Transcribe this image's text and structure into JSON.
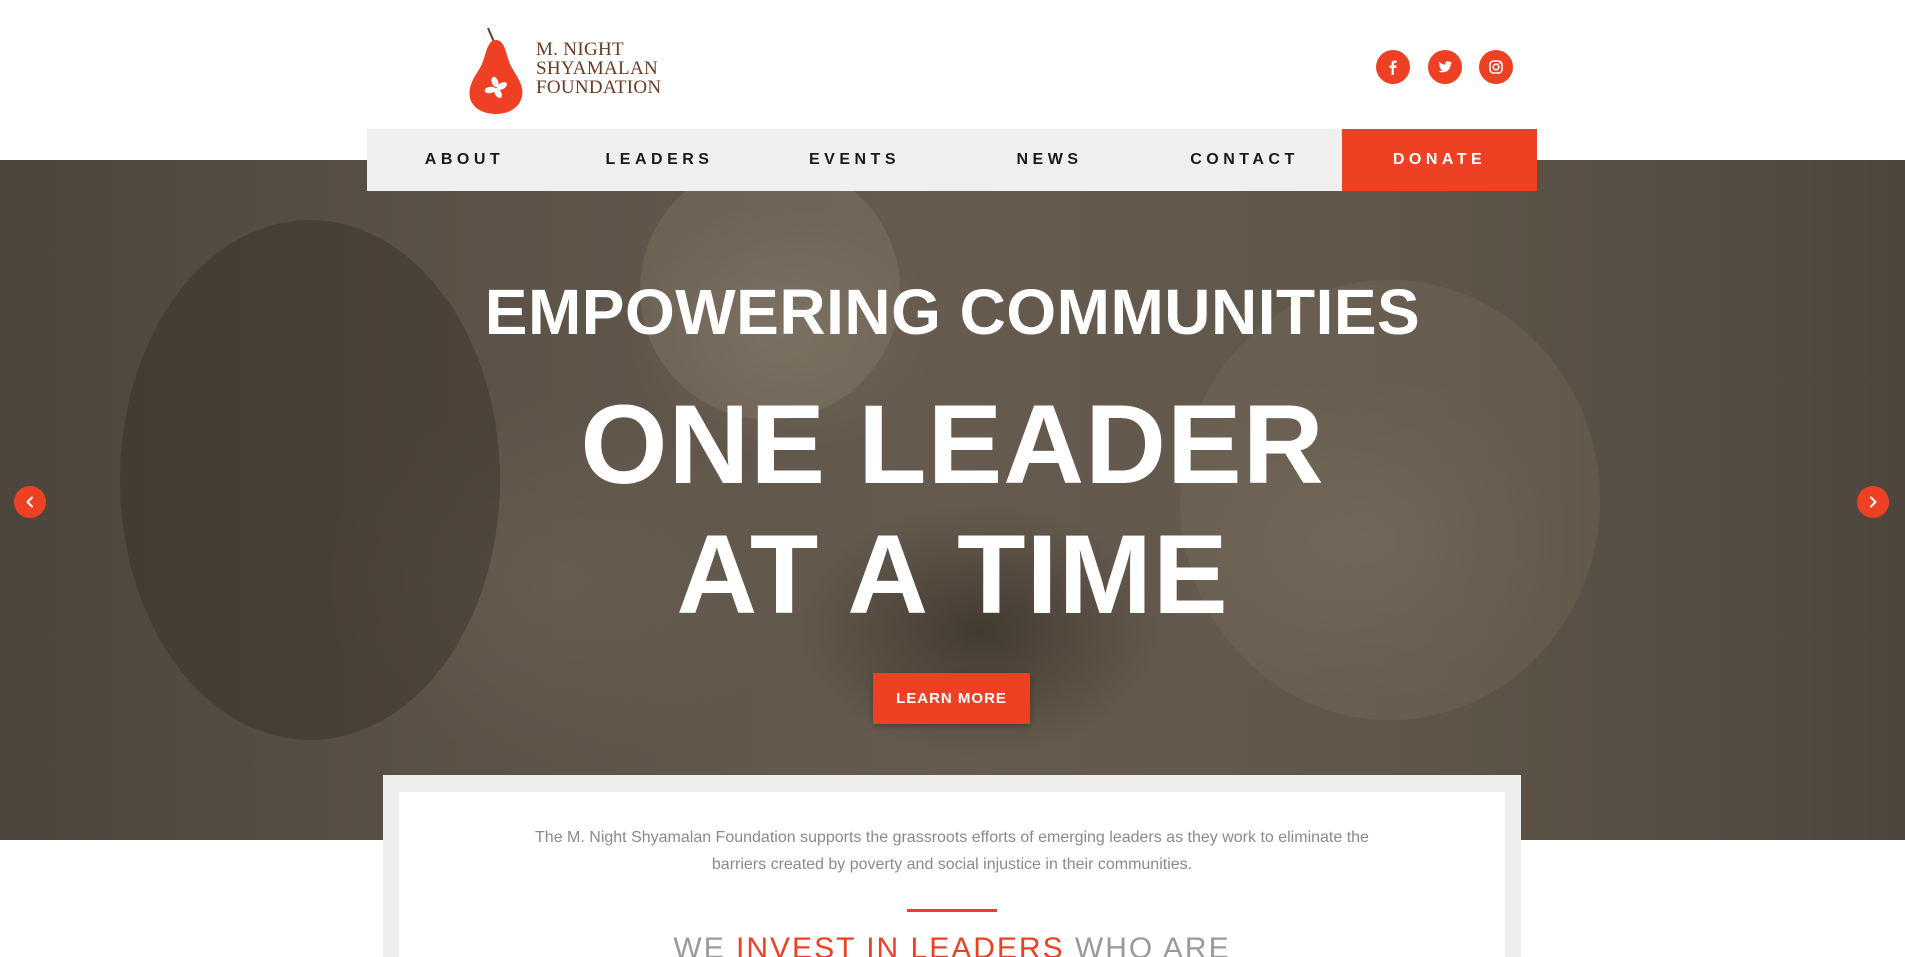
{
  "brand": {
    "logo_line1": "M. NIGHT",
    "logo_line2": "SHYAMALAN",
    "logo_line3": "FOUNDATION",
    "accent_color": "#ee4124",
    "logo_text_color": "#6b3a22"
  },
  "social": [
    {
      "name": "facebook",
      "icon": "facebook-icon"
    },
    {
      "name": "twitter",
      "icon": "twitter-icon"
    },
    {
      "name": "instagram",
      "icon": "instagram-icon"
    }
  ],
  "nav": {
    "items": [
      {
        "label": "ABOUT"
      },
      {
        "label": "LEADERS"
      },
      {
        "label": "EVENTS"
      },
      {
        "label": "NEWS"
      },
      {
        "label": "CONTACT"
      },
      {
        "label": "DONATE"
      }
    ]
  },
  "hero": {
    "subtitle": "EMPOWERING COMMUNITIES",
    "title_line1": "ONE LEADER",
    "title_line2": "AT A TIME",
    "cta_label": "LEARN MORE",
    "prev_icon": "chevron-left-icon",
    "next_icon": "chevron-right-icon"
  },
  "intro": {
    "text": "The M. Night Shyamalan Foundation supports the grassroots efforts of emerging leaders as they work to eliminate the barriers created by poverty and social injustice in their communities.",
    "tagline_prefix": "WE ",
    "tagline_accent": "INVEST IN LEADERS",
    "tagline_suffix": " WHO ARE"
  }
}
